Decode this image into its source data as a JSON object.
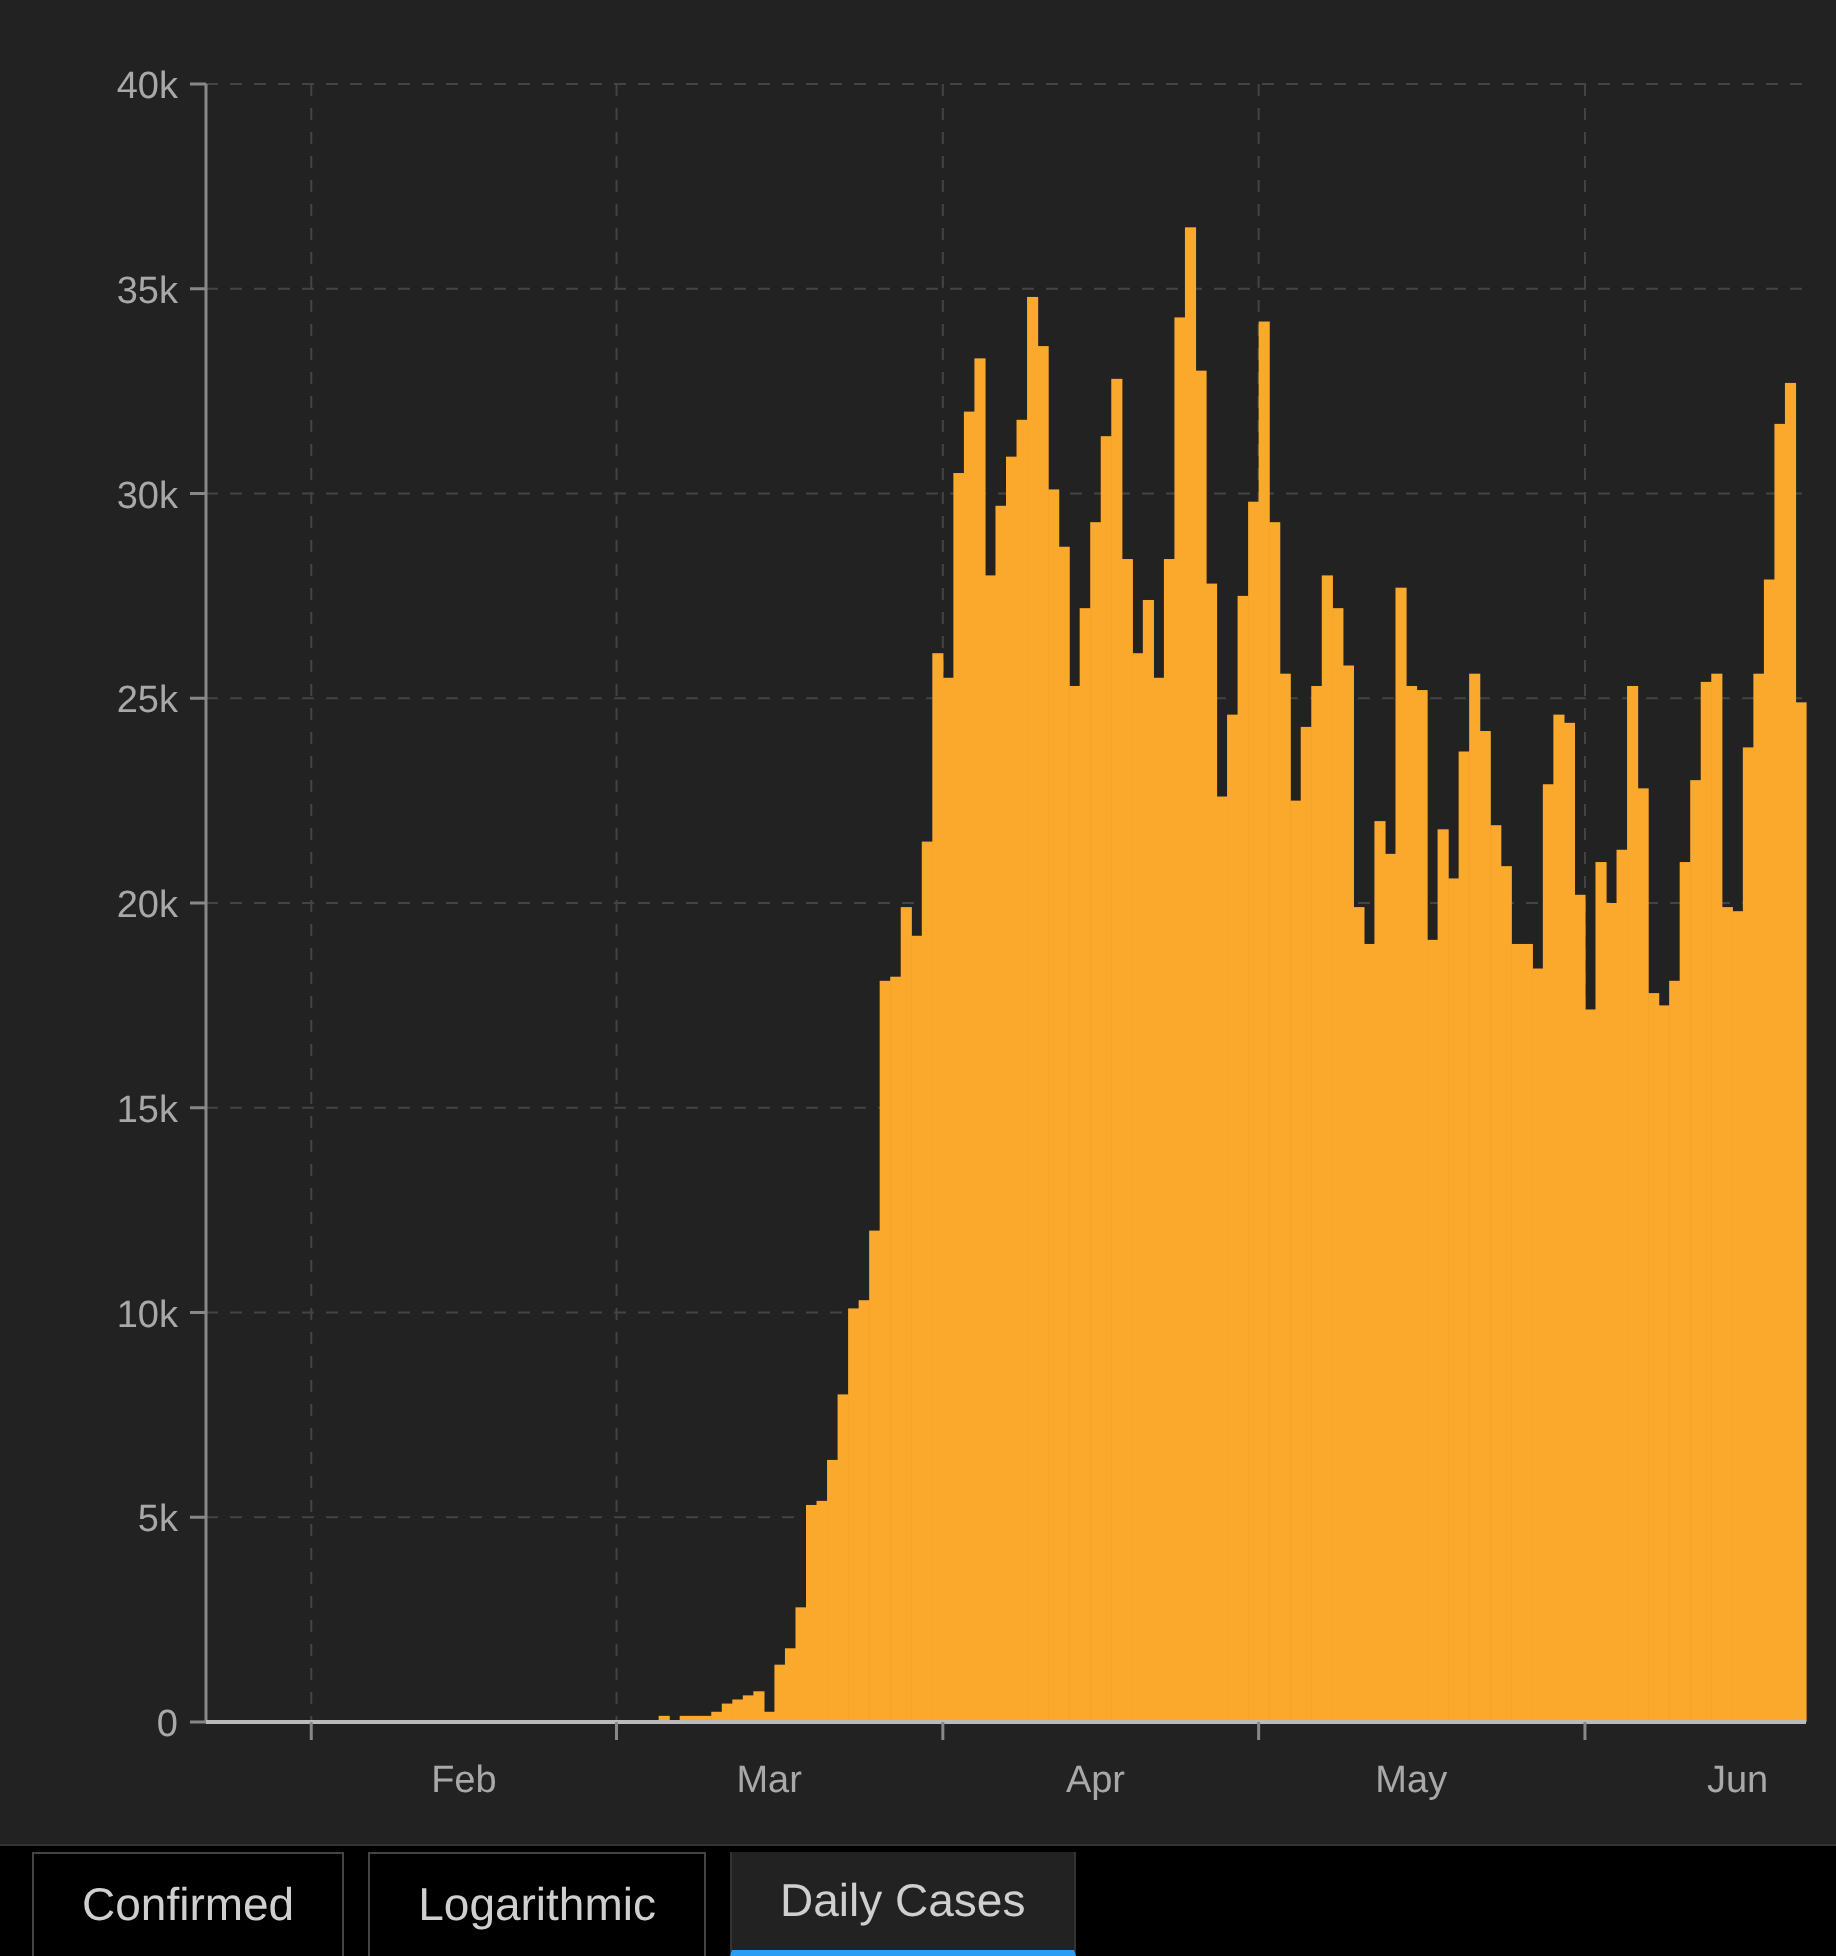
{
  "chart": {
    "chart_data": {
      "type": "bar",
      "grid": true,
      "ylim": [
        0,
        40000
      ],
      "categories": [
        null,
        null,
        null,
        null,
        null,
        null,
        null,
        null,
        null,
        null,
        null,
        null,
        null,
        null,
        null,
        null,
        null,
        null,
        null,
        null,
        null,
        null,
        null,
        null,
        "Feb",
        null,
        null,
        null,
        null,
        null,
        null,
        null,
        null,
        null,
        null,
        null,
        null,
        null,
        null,
        null,
        null,
        null,
        null,
        null,
        null,
        null,
        null,
        null,
        null,
        null,
        null,
        null,
        null,
        "Mar",
        null,
        null,
        null,
        null,
        null,
        null,
        null,
        null,
        null,
        null,
        null,
        null,
        null,
        null,
        null,
        null,
        null,
        null,
        null,
        null,
        null,
        null,
        null,
        null,
        null,
        null,
        null,
        null,
        null,
        null,
        "Apr",
        null,
        null,
        null,
        null,
        null,
        null,
        null,
        null,
        null,
        null,
        null,
        null,
        null,
        null,
        null,
        null,
        null,
        null,
        null,
        null,
        null,
        null,
        null,
        null,
        null,
        null,
        null,
        null,
        null,
        "May",
        null,
        null,
        null,
        null,
        null,
        null,
        null,
        null,
        null,
        null,
        null,
        null,
        null,
        null,
        null,
        null,
        null,
        null,
        null,
        null,
        null,
        null,
        null,
        null,
        null,
        null,
        null,
        null,
        null,
        null,
        "Jun",
        null,
        null,
        null,
        null,
        null,
        null
      ],
      "yticks": [
        {
          "value": 0,
          "label": "0"
        },
        {
          "value": 5000,
          "label": "5k"
        },
        {
          "value": 10000,
          "label": "10k"
        },
        {
          "value": 15000,
          "label": "15k"
        },
        {
          "value": 20000,
          "label": "20k"
        },
        {
          "value": 25000,
          "label": "25k"
        },
        {
          "value": 30000,
          "label": "30k"
        },
        {
          "value": 35000,
          "label": "35k"
        },
        {
          "value": 40000,
          "label": "40k"
        }
      ],
      "series": [
        {
          "color": "#fba92c",
          "values": [
            0,
            0,
            0,
            0,
            0,
            0,
            0,
            0,
            0,
            0,
            0,
            0,
            0,
            0,
            0,
            0,
            0,
            0,
            0,
            0,
            0,
            0,
            0,
            0,
            0,
            0,
            0,
            0,
            0,
            0,
            0,
            0,
            0,
            0,
            0,
            0,
            0,
            0,
            0,
            0,
            0,
            0,
            0,
            150,
            null,
            150,
            150,
            150,
            250,
            450,
            550,
            650,
            750,
            250,
            1400,
            1800,
            2800,
            5300,
            5400,
            6400,
            8000,
            10100,
            10300,
            12000,
            18100,
            18200,
            19900,
            19200,
            21500,
            26100,
            25500,
            30500,
            32000,
            33300,
            28000,
            29700,
            30900,
            31800,
            34800,
            33600,
            30100,
            28700,
            25300,
            27200,
            29300,
            31400,
            32800,
            28400,
            26100,
            27400,
            25500,
            28400,
            34300,
            36500,
            33000,
            27800,
            22600,
            24600,
            27500,
            29800,
            34200,
            29300,
            25600,
            22500,
            24300,
            25300,
            28000,
            27200,
            25800,
            19900,
            19000,
            22000,
            21200,
            27700,
            25300,
            25200,
            19100,
            21800,
            20600,
            23700,
            25600,
            24200,
            21900,
            20900,
            19000,
            19000,
            18400,
            22900,
            24600,
            24400,
            20200,
            17400,
            21000,
            20000,
            21300,
            25300,
            22800,
            17800,
            17500,
            18100,
            21000,
            23000,
            25400,
            25600,
            19900,
            19800,
            23800,
            25600,
            27900,
            31700,
            32700,
            24900
          ]
        }
      ]
    }
  },
  "tabs": [
    {
      "label": "Confirmed",
      "selected": false
    },
    {
      "label": "Logarithmic",
      "selected": false
    },
    {
      "label": "Daily Cases",
      "selected": true
    }
  ]
}
